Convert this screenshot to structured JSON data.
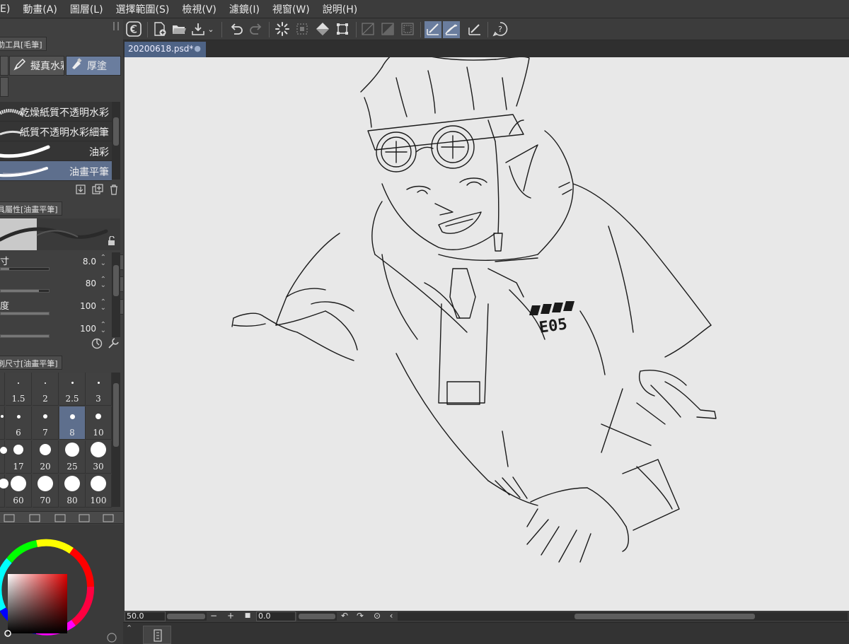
{
  "menu": [
    "E)",
    "動畫(A)",
    "圖層(L)",
    "選擇範圍(S)",
    "檢視(V)",
    "濾鏡(I)",
    "視窗(W)",
    "說明(H)"
  ],
  "subtool_panel": {
    "title": "助工具[毛筆]",
    "tools": [
      {
        "label": "",
        "icon": "sparkle-icon",
        "active": false
      },
      {
        "label": "擬真水彩",
        "icon": "pen-icon",
        "active": false
      },
      {
        "label": "厚塗",
        "icon": "paint-tube-icon",
        "active": true
      }
    ],
    "brushes": [
      {
        "name": "乾燥紙質不透明水彩",
        "selected": false
      },
      {
        "name": "紙質不透明水彩細筆",
        "selected": false
      },
      {
        "name": "油彩",
        "selected": false
      },
      {
        "name": "油畫平筆",
        "selected": true
      }
    ],
    "footer_icons": [
      "copy-to-icon",
      "duplicate-icon",
      "trash-icon"
    ]
  },
  "tool_property": {
    "title": "具屬性[油畫平筆]",
    "rows": [
      {
        "label": "寸",
        "value": "8.0",
        "fill": 0.18
      },
      {
        "label": "",
        "value": "80",
        "fill": 0.8
      },
      {
        "label": "度",
        "value": "100",
        "fill": 1.0
      },
      {
        "label": "",
        "value": "100",
        "fill": 1.0
      }
    ]
  },
  "brush_size": {
    "title": "刷尺寸[油畫平筆]",
    "sizes": [
      "1.5",
      "2",
      "2.5",
      "3",
      "6",
      "7",
      "8",
      "10",
      "17",
      "20",
      "25",
      "30",
      "60",
      "70",
      "80",
      "100"
    ],
    "selected": "8"
  },
  "toolbar": {
    "icons": [
      "logo-icon",
      "new-file-icon",
      "open-folder-icon",
      "save-icon",
      "dropdown-chevron-icon",
      "undo-icon",
      "redo-icon",
      "loading-icon",
      "clear-selection-icon",
      "fill-icon",
      "transform-icon",
      "ruler-a-icon",
      "ruler-b-icon",
      "ruler-c-icon",
      "snap-ruler-icon",
      "snap-special-icon",
      "snap-grid-icon",
      "help-icon"
    ]
  },
  "document": {
    "tab_title": "20200618.psd*",
    "close_glyph": "●"
  },
  "canvas": {
    "badge_text": "E05"
  },
  "statusbar": {
    "zoom": "50.0",
    "rotation": "0.0"
  },
  "colors": {
    "accent": "#6a7d9e",
    "selected_row": "#5e6f8d",
    "canvas_bg": "#e8e8e8"
  }
}
